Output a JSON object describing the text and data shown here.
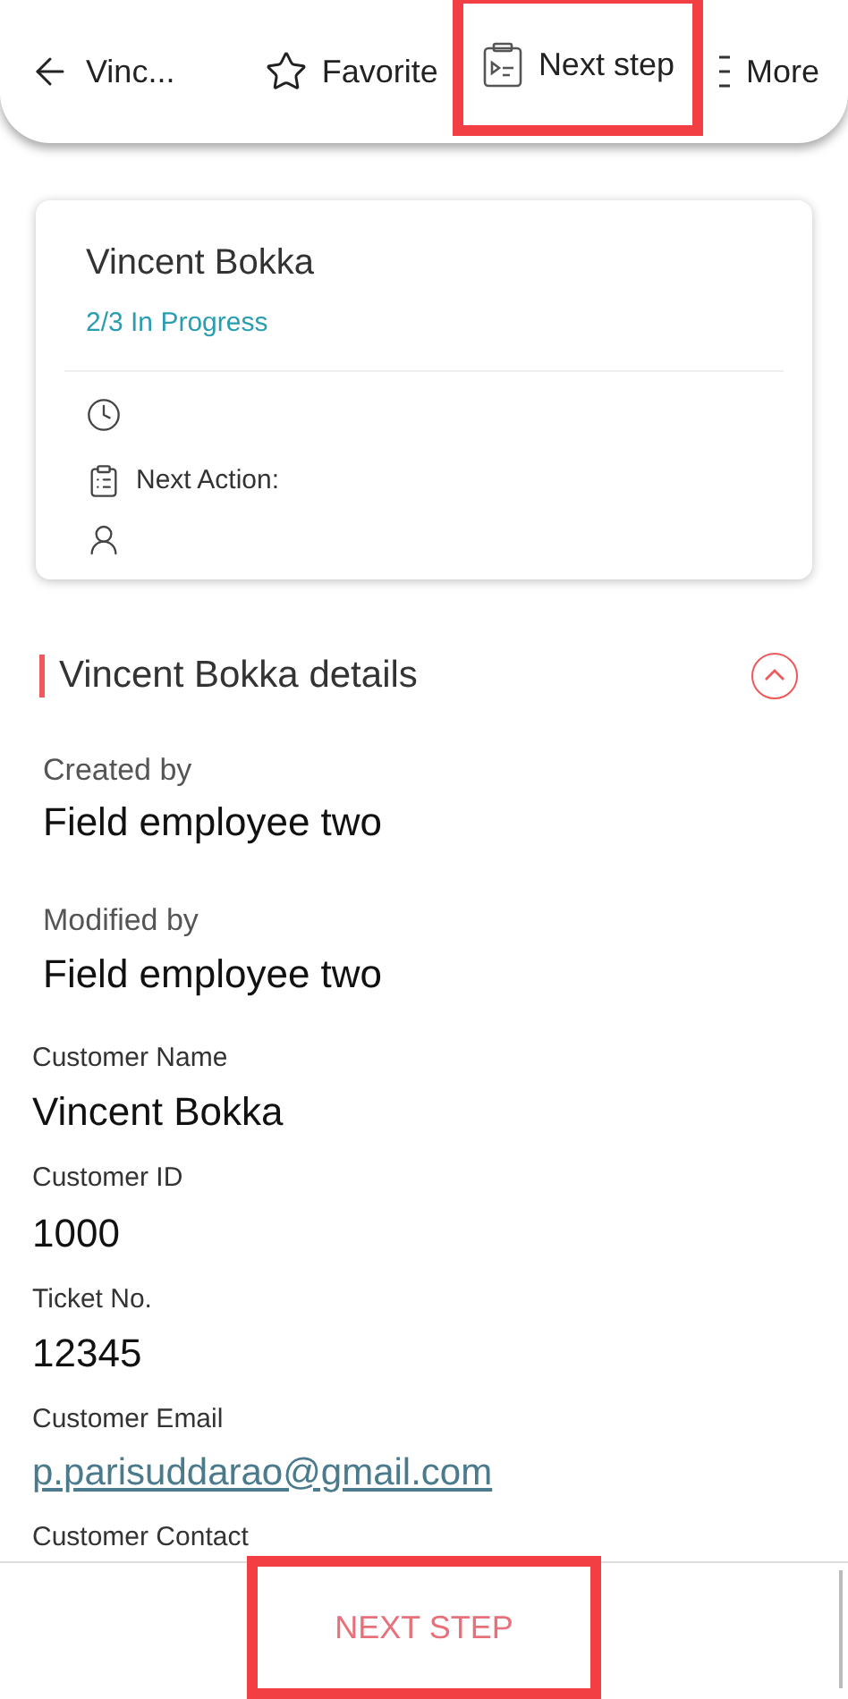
{
  "toolbar": [
    {
      "kind": "back",
      "label": "Vinc...",
      "highlighted": false
    },
    {
      "kind": "favorite",
      "label": "Favorite",
      "highlighted": false
    },
    {
      "kind": "next",
      "label": "Next step",
      "highlighted": true
    },
    {
      "kind": "more",
      "label": "More",
      "highlighted": false
    }
  ],
  "card": {
    "title": "Vincent Bokka",
    "status": "2/3 In Progress",
    "next_action_label": "Next Action:"
  },
  "section": {
    "title": "Vincent Bokka details",
    "expanded": true
  },
  "audit": [
    {
      "label": "Created by",
      "value": "Field employee two"
    },
    {
      "label": "Modified by",
      "value": "Field employee two"
    }
  ],
  "fields": [
    {
      "kind": "text",
      "label": "Customer Name",
      "value": "Vincent Bokka"
    },
    {
      "kind": "text",
      "label": "Customer ID",
      "value": "1000"
    },
    {
      "kind": "text",
      "label": "Ticket No.",
      "value": "12345"
    },
    {
      "kind": "link",
      "label": "Customer Email",
      "value": "p.parisuddarao@gmail.com"
    },
    {
      "kind": "text",
      "label": "Customer Contact"
    }
  ],
  "bottom_button": {
    "label": "NEXT STEP",
    "highlighted": true
  }
}
